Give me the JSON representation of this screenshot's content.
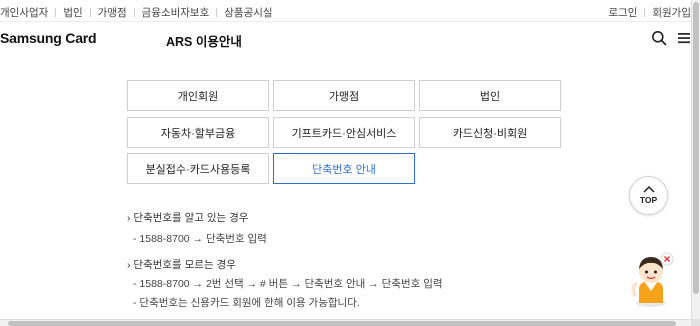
{
  "util": {
    "left": [
      "개인사업자",
      "법인",
      "가맹점",
      "금융소비자보호",
      "상품공시실"
    ],
    "login": "로그인",
    "join": "회원가입"
  },
  "header": {
    "logo": "Samsung Card",
    "title": "ARS 이용안내",
    "icons": [
      "search-icon",
      "menu-icon"
    ]
  },
  "tabs": [
    {
      "label": "개인회원",
      "active": false
    },
    {
      "label": "가맹점",
      "active": false
    },
    {
      "label": "법인",
      "active": false
    },
    {
      "label": "자동차·할부금융",
      "active": false
    },
    {
      "label": "기프트카드·안심서비스",
      "active": false
    },
    {
      "label": "카드신청·비회원",
      "active": false
    },
    {
      "label": "분실접수·카드사용등록",
      "active": false
    },
    {
      "label": "단축번호 안내",
      "active": true
    }
  ],
  "content": {
    "known_title": "› 단축번호를 알고 있는 경우",
    "known_line": "- 1588-8700 → 단축번호 입력",
    "unknown_title": "› 단축번호를 모르는 경우",
    "unknown_line1": "- 1588-8700 → 2번 선택 → # 버튼 → 단축번호 안내 → 단축번호 입력",
    "unknown_line2": "- 단축번호는 신용카드 회원에 한해 이용 가능합니다."
  },
  "top_button": {
    "label": "TOP"
  },
  "colors": {
    "accent": "#2f6fd0",
    "border": "#cfcfcf"
  }
}
